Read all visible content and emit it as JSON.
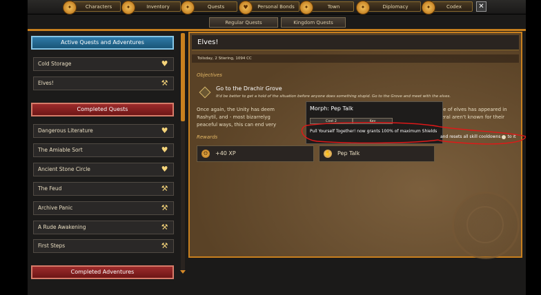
{
  "nav": {
    "tabs": [
      {
        "label": "Characters",
        "icon": "characters-icon"
      },
      {
        "label": "Inventory",
        "icon": "inventory-icon"
      },
      {
        "label": "Quests",
        "icon": "quests-icon"
      },
      {
        "label": "Personal Bonds",
        "icon": "bonds-icon"
      },
      {
        "label": "Town",
        "icon": "town-icon"
      },
      {
        "label": "Diplomacy",
        "icon": "diplomacy-icon"
      },
      {
        "label": "Codex",
        "icon": "codex-icon"
      }
    ],
    "close": "✕"
  },
  "subtabs": [
    "Regular Quests",
    "Kingdom Quests"
  ],
  "sidebar": {
    "active_header": "Active Quests and Adventures",
    "active": [
      {
        "label": "Cold Storage",
        "icon": "heart-icon"
      },
      {
        "label": "Elves!",
        "icon": "wrench-icon"
      }
    ],
    "completed_header": "Completed Quests",
    "completed": [
      {
        "label": "Dangerous Literature",
        "icon": "heart-icon"
      },
      {
        "label": "The Amiable Sort",
        "icon": "heart-icon"
      },
      {
        "label": "Ancient Stone Circle",
        "icon": "heart-icon"
      },
      {
        "label": "The Feud",
        "icon": "wrench-icon"
      },
      {
        "label": "Archive Panic",
        "icon": "wrench-icon"
      },
      {
        "label": "A Rude Awakening",
        "icon": "wrench-icon"
      },
      {
        "label": "First Steps",
        "icon": "wrench-icon"
      }
    ],
    "adventures_header": "Completed Adventures"
  },
  "quest": {
    "title": "Elves!",
    "date": "Toilsday, 2 Stiering, 1094 CC",
    "objectives_label": "Objectives",
    "objective_title": "Go to the Drachir Grove",
    "objective_desc": "It'd be better to get a hold of the situation before anyone does something stupid. Go to the Grove and meet with the elves.",
    "body_line1_a": "Once again, the Unity has deem",
    "body_line1_b": "known coterie of elves has appeared in",
    "body_line2_a": "Rashytil, and - most bizarrelyg",
    "body_line2_b": "elves in general aren't known for their",
    "body_line3_a": "peaceful ways, this can end very",
    "rewards_label": "Rewards",
    "rewards": [
      {
        "label": "+40 XP",
        "icon": "xp-coin-icon"
      },
      {
        "label": "Pep Talk",
        "icon": "pep-talk-icon"
      }
    ]
  },
  "tooltip": {
    "title": "Morph: Pep Talk",
    "cost": "Cost 2",
    "key": "Key",
    "desc": "Pull Yourself Together! now grants 100% of maximum Shields",
    "tail": "and resets all skill cooldowns",
    "tail_end": "to it"
  },
  "colors": {
    "accent": "#c9801e",
    "annotation": "#e01818"
  }
}
